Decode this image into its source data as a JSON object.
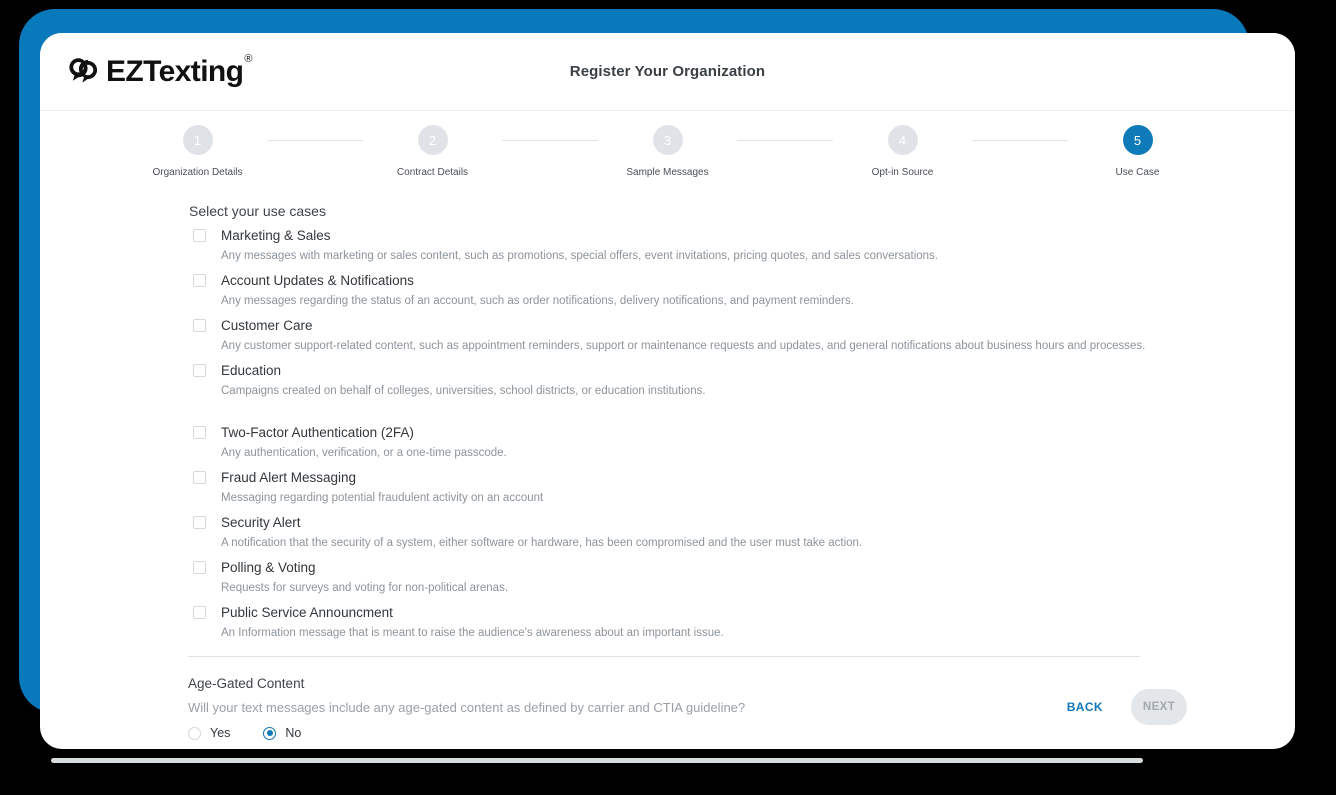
{
  "colors": {
    "brand_blue": "#0879bb",
    "accent_blue": "#1178b8",
    "step_inactive": "#dfe3e8",
    "text_dark": "#32373c",
    "text_muted": "#8d949b"
  },
  "header": {
    "logo_text": "EZTexting",
    "logo_mark": "interlocking-speech-bubbles",
    "title": "Register Your Organization"
  },
  "stepper": {
    "steps": [
      {
        "number": "1",
        "label": "Organization Details",
        "active": false
      },
      {
        "number": "2",
        "label": "Contract Details",
        "active": false
      },
      {
        "number": "3",
        "label": "Sample Messages",
        "active": false
      },
      {
        "number": "4",
        "label": "Opt-in Source",
        "active": false
      },
      {
        "number": "5",
        "label": "Use Case",
        "active": true
      }
    ]
  },
  "main": {
    "section_title": "Select your use cases",
    "use_cases": [
      {
        "title": "Marketing & Sales",
        "description": "Any messages with marketing or sales content, such as promotions, special offers, event invitations, pricing quotes, and sales conversations.",
        "checked": false
      },
      {
        "title": "Account Updates & Notifications",
        "description": "Any messages regarding the status of an account, such as order notifications, delivery notifications, and payment reminders.",
        "checked": false
      },
      {
        "title": "Customer Care",
        "description": "Any customer support-related content, such as appointment reminders, support or maintenance requests and updates, and general notifications about business hours and processes.",
        "checked": false
      },
      {
        "title": "Education",
        "description": "Campaigns created on behalf of colleges, universities, school districts, or education institutions.",
        "checked": false
      },
      {
        "title": "Two-Factor Authentication (2FA)",
        "description": "Any authentication, verification, or a one-time passcode.",
        "checked": false
      },
      {
        "title": "Fraud Alert Messaging",
        "description": "Messaging regarding potential fraudulent activity on an account",
        "checked": false
      },
      {
        "title": "Security Alert",
        "description": "A notification that the security of a system, either software or hardware, has been compromised and the user must take action.",
        "checked": false
      },
      {
        "title": "Polling & Voting",
        "description": "Requests for surveys and voting for non-political arenas.",
        "checked": false
      },
      {
        "title": "Public Service Announcment",
        "description": "An Information message that is meant to raise the audience's awareness about an important issue.",
        "checked": false
      }
    ],
    "age_gated": {
      "title": "Age-Gated Content",
      "question": "Will your text messages include any age-gated content as defined by carrier and CTIA guideline?",
      "options": [
        {
          "label": "Yes",
          "selected": false
        },
        {
          "label": "No",
          "selected": true
        }
      ]
    }
  },
  "footer": {
    "back_label": "BACK",
    "next_label": "NEXT",
    "next_disabled": true
  }
}
